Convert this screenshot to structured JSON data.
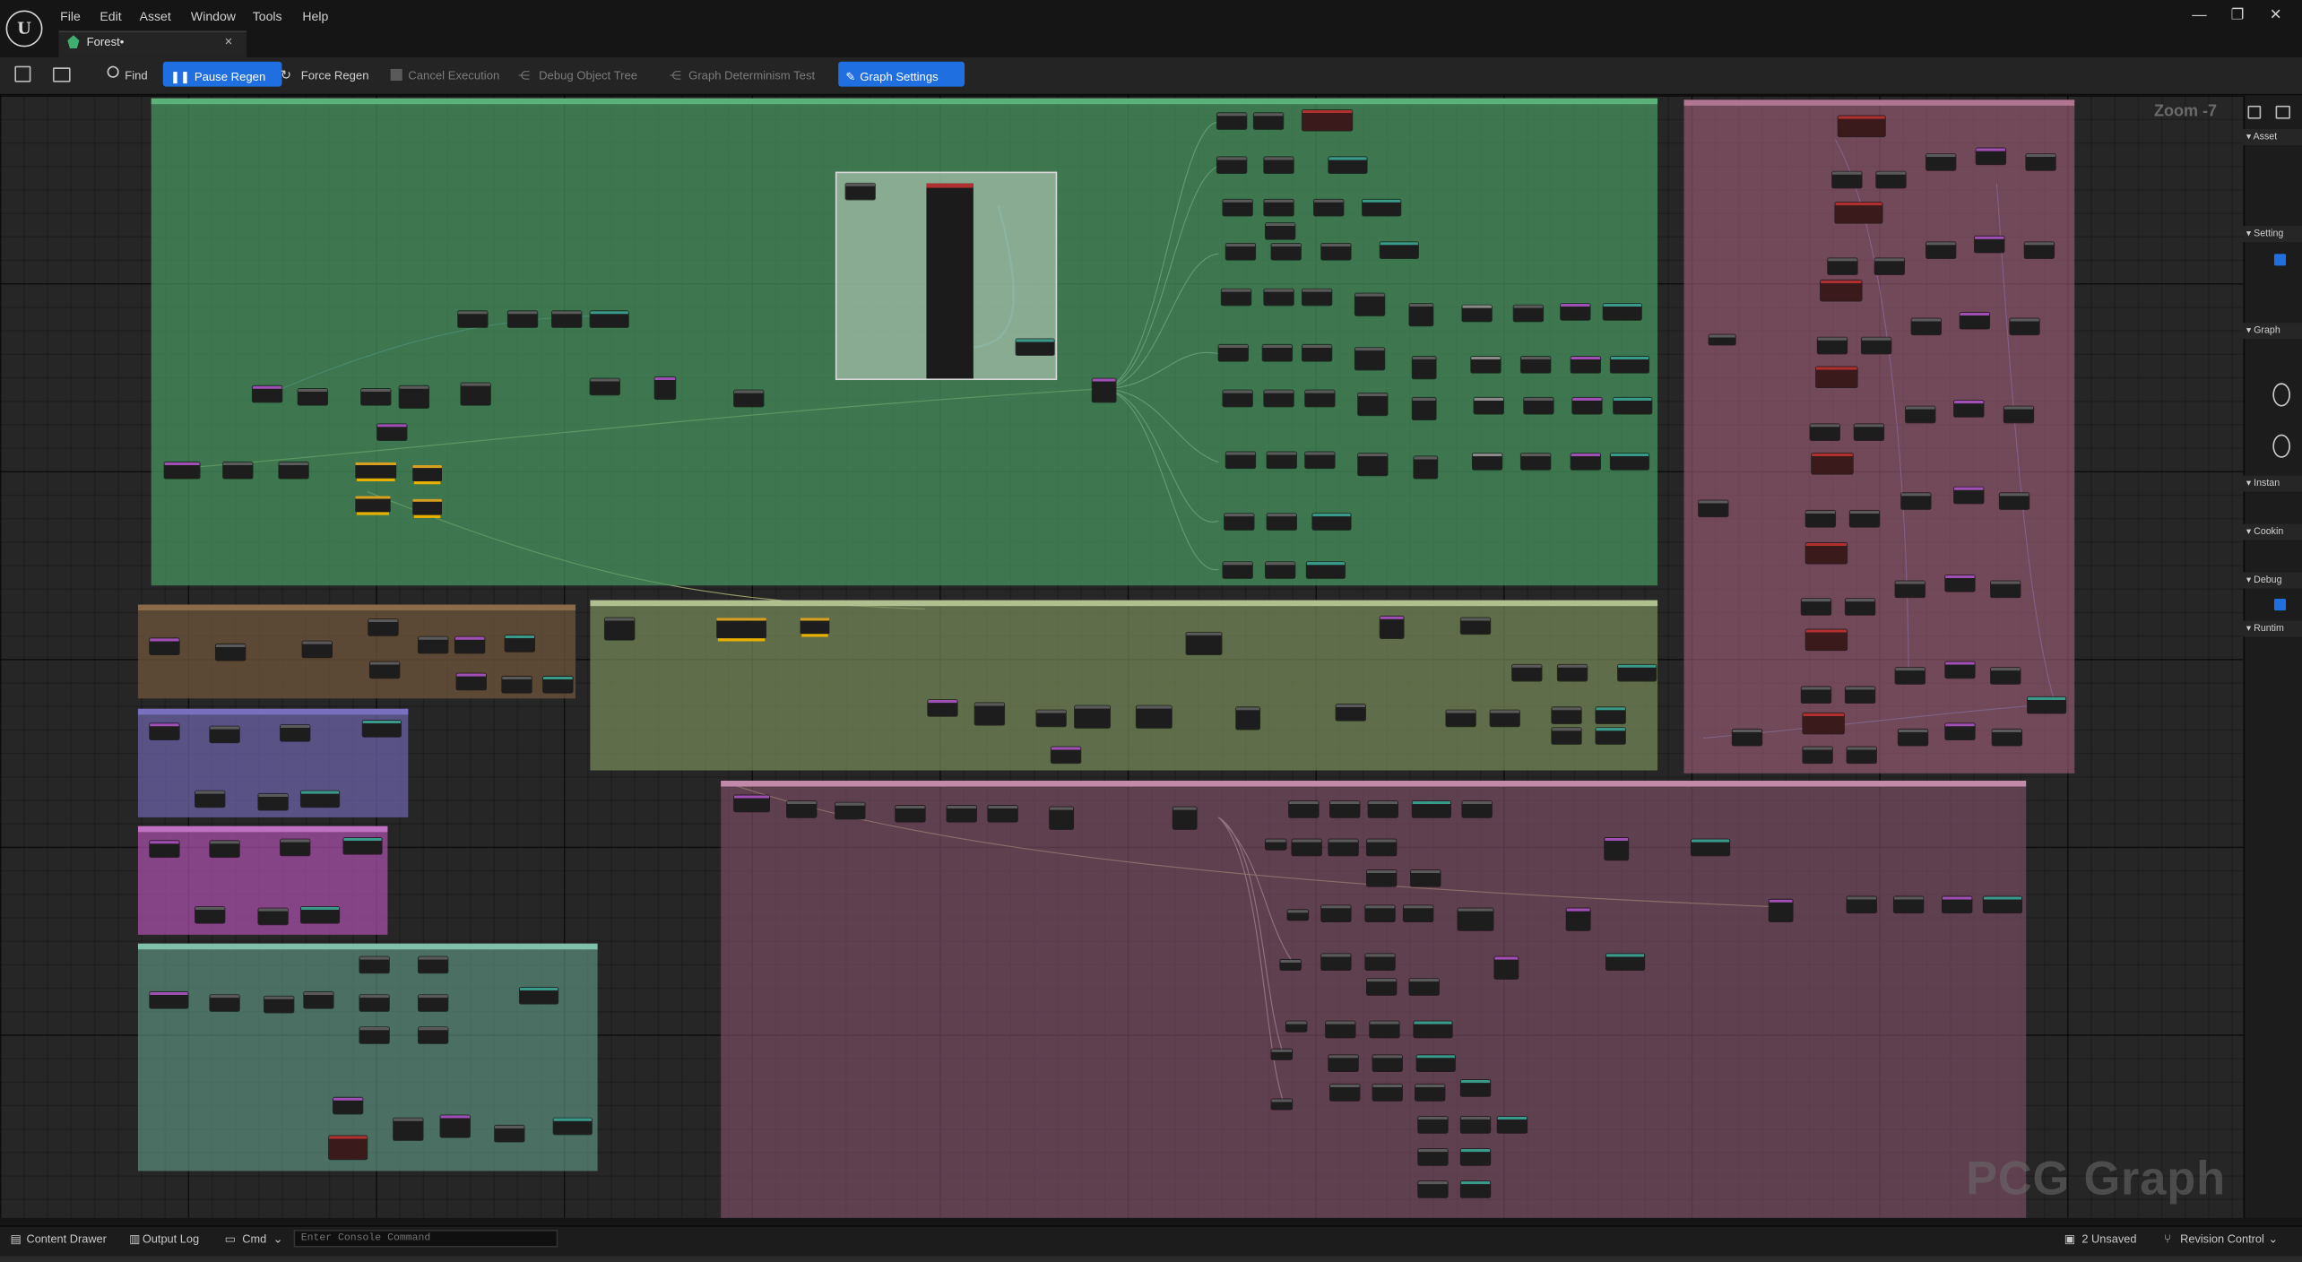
{
  "menu": [
    "File",
    "Edit",
    "Asset",
    "Window",
    "Tools",
    "Help"
  ],
  "document_tab": {
    "label": "Forest•",
    "close": "×"
  },
  "window_controls": {
    "minimize": "—",
    "maximize": "❐",
    "close": "✕"
  },
  "toolbar": {
    "find": "Find",
    "pause_regen": "Pause Regen",
    "force_regen": "Force Regen",
    "cancel_execution": "Cancel Execution",
    "debug_object_tree": "Debug Object Tree",
    "graph_determinism_test": "Graph Determinism Test",
    "graph_settings": "Graph Settings"
  },
  "graph": {
    "zoom": "Zoom -7",
    "watermark": "PCG Graph",
    "accent": "#1f6fe0"
  },
  "details_panel": {
    "sections": [
      "Asset",
      "Setting",
      "Graph",
      "Instan",
      "Cookin",
      "Debug",
      "Runtim"
    ]
  },
  "status_bar": {
    "content_drawer": "Content Drawer",
    "output_log": "Output Log",
    "cmd": "Cmd",
    "console_placeholder": "Enter Console Command",
    "unsaved": "2 Unsaved",
    "revision_control": "Revision Control"
  }
}
